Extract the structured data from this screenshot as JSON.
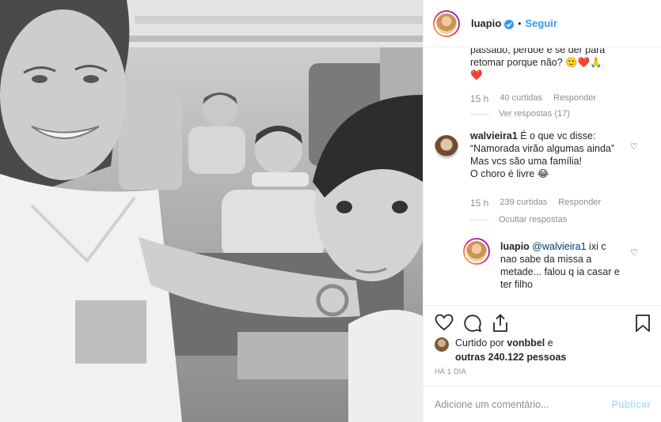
{
  "header": {
    "username": "luapio",
    "separator": "•",
    "follow_label": "Seguir"
  },
  "comments": {
    "partial": {
      "line1": "passado, perdoe e se der para",
      "line2": "retomar porque não? 🙂❤️🙏",
      "line3": "❤️",
      "time": "15 h",
      "likes": "40 curtidas",
      "reply_label": "Responder",
      "view_replies": "Ver respostas (17)"
    },
    "second": {
      "username": "walvieira1",
      "line1": "É o que vc disse:",
      "line2": "“Namorada virão algumas ainda”",
      "line3": "Mas vcs são uma família!",
      "line4": "O choro é livre 😂",
      "time": "15 h",
      "likes": "239 curtidas",
      "reply_label": "Responder",
      "hide_replies": "Ocultar respostas"
    },
    "reply": {
      "username": "luapio",
      "mention": "@walvieira1",
      "line1": " ixi c",
      "line2": "nao sabe da missa a",
      "line3": "metade... falou q ia casar e",
      "line4": "ter filho"
    }
  },
  "likes": {
    "prefix": "Curtido por",
    "user": "vonbbel",
    "connector": "e",
    "others": "outras 240.122 pessoas"
  },
  "time_ago": "HÁ 1 DIA",
  "add_comment": {
    "placeholder": "Adicione um comentário...",
    "publish_label": "Publicar"
  }
}
